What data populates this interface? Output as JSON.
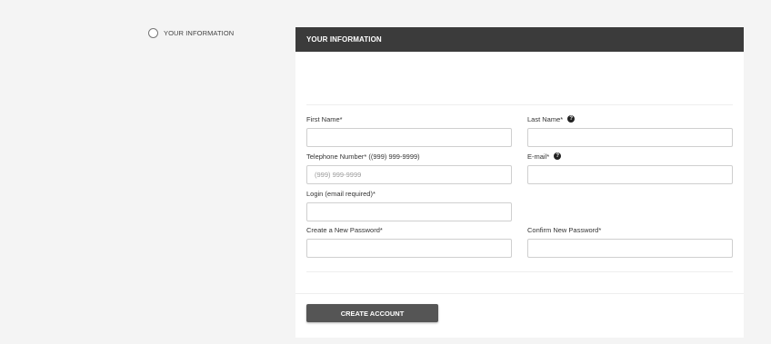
{
  "steps": [
    {
      "label": "YOUR INFORMATION"
    }
  ],
  "panel": {
    "title": "YOUR INFORMATION"
  },
  "form": {
    "first_name": {
      "label": "First Name*",
      "value": "",
      "placeholder": ""
    },
    "last_name": {
      "label": "Last Name*",
      "value": "",
      "placeholder": "",
      "help_icon": "question-circle-icon"
    },
    "telephone": {
      "label": "Telephone Number* ((999) 999-9999)",
      "value": "",
      "placeholder": "(999) 999-9999"
    },
    "email": {
      "label": "E-mail*",
      "value": "",
      "placeholder": "",
      "help_icon": "question-circle-icon"
    },
    "login": {
      "label": "Login (email required)*",
      "value": "",
      "placeholder": ""
    },
    "new_password": {
      "label": "Create a New Password*",
      "value": "",
      "placeholder": ""
    },
    "confirm_password": {
      "label": "Confirm New Password*",
      "value": "",
      "placeholder": ""
    }
  },
  "actions": {
    "create_account_label": "CREATE ACCOUNT"
  },
  "colors": {
    "header_bg": "#3b3b3b",
    "button_bg": "#555555",
    "page_bg": "#f4f4f4"
  }
}
